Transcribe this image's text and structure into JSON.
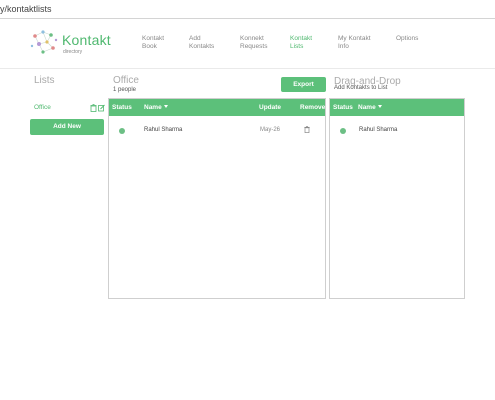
{
  "browser": {
    "url": "y/kontaktlists"
  },
  "brand": {
    "name": "Kontakt",
    "tagline": "directory",
    "accent": "#4fb86f"
  },
  "nav": [
    {
      "label": "Kontakt\nBook",
      "active": false
    },
    {
      "label": "Add\nKontakts",
      "active": false
    },
    {
      "label": "Konnekt\nRequests",
      "active": false
    },
    {
      "label": "Kontakt\nLists",
      "active": true
    },
    {
      "label": "My Kontakt\nInfo",
      "active": false
    },
    {
      "label": "Options",
      "active": false
    }
  ],
  "lists": {
    "title": "Lists",
    "items": [
      {
        "label": "Office",
        "icons": [
          "trash-icon",
          "edit-icon"
        ]
      }
    ],
    "add_button": "Add New"
  },
  "office": {
    "title": "Office",
    "count": "1 people",
    "export_button": "Export",
    "columns": {
      "status": "Status",
      "name": "Name",
      "update": "Update",
      "remove": "Remove"
    },
    "rows": [
      {
        "status": "online",
        "name": "Rahul Sharma",
        "update": "May-26"
      }
    ]
  },
  "dnd": {
    "title": "Drag-and-Drop",
    "subtitle": "Add Kontakts to List",
    "columns": {
      "status": "Status",
      "name": "Name"
    },
    "rows": [
      {
        "status": "online",
        "name": "Rahul Sharma"
      }
    ]
  }
}
